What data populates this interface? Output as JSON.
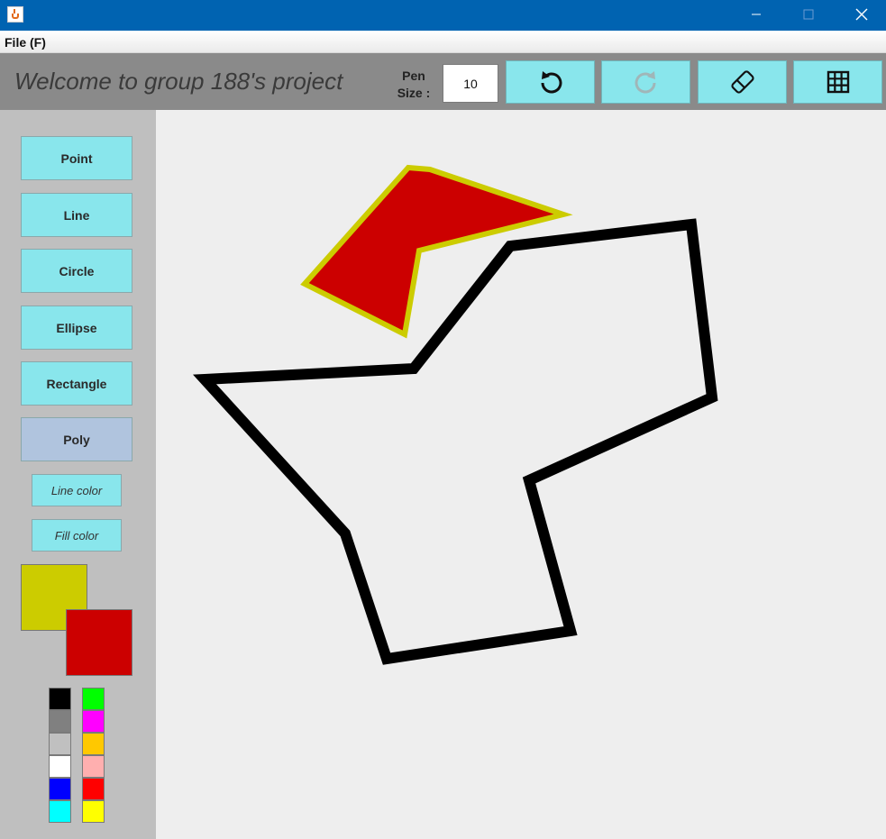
{
  "window": {
    "title": ""
  },
  "menu": {
    "file_label": "File (F)"
  },
  "header": {
    "welcome": "Welcome to group 188's project",
    "pen_size_label_line1": "Pen",
    "pen_size_label_line2": "Size :",
    "pen_size_value": "10",
    "tools": [
      {
        "name": "undo",
        "icon": "undo-icon",
        "enabled": true
      },
      {
        "name": "redo",
        "icon": "redo-icon",
        "enabled": false
      },
      {
        "name": "eraser",
        "icon": "eraser-icon",
        "enabled": true
      },
      {
        "name": "grid",
        "icon": "grid-icon",
        "enabled": true
      }
    ]
  },
  "sidebar": {
    "shapes": [
      {
        "label": "Point"
      },
      {
        "label": "Line"
      },
      {
        "label": "Circle"
      },
      {
        "label": "Ellipse"
      },
      {
        "label": "Rectangle"
      },
      {
        "label": "Poly",
        "selected": true
      }
    ],
    "line_color_label": "Line color",
    "fill_color_label": "Fill color",
    "current_line_color": "#cccc00",
    "current_fill_color": "#cc0000",
    "palette": [
      [
        "#000000",
        "#00ff00"
      ],
      [
        "#808080",
        "#ff00ff"
      ],
      [
        "#c0c0c0",
        "#ffc800"
      ],
      [
        "#ffffff",
        "#ffafaf"
      ],
      [
        "#0000ff",
        "#ff0000"
      ],
      [
        "#00ffff",
        "#ffff00"
      ]
    ]
  },
  "canvas": {
    "background": "#eeeeee",
    "shapes": [
      {
        "type": "polygon",
        "stroke": "#cccc00",
        "fill": "#cc0000",
        "pen_size": 6
      },
      {
        "type": "polygon",
        "stroke": "#000000",
        "fill": "none",
        "pen_size": 12
      }
    ]
  }
}
